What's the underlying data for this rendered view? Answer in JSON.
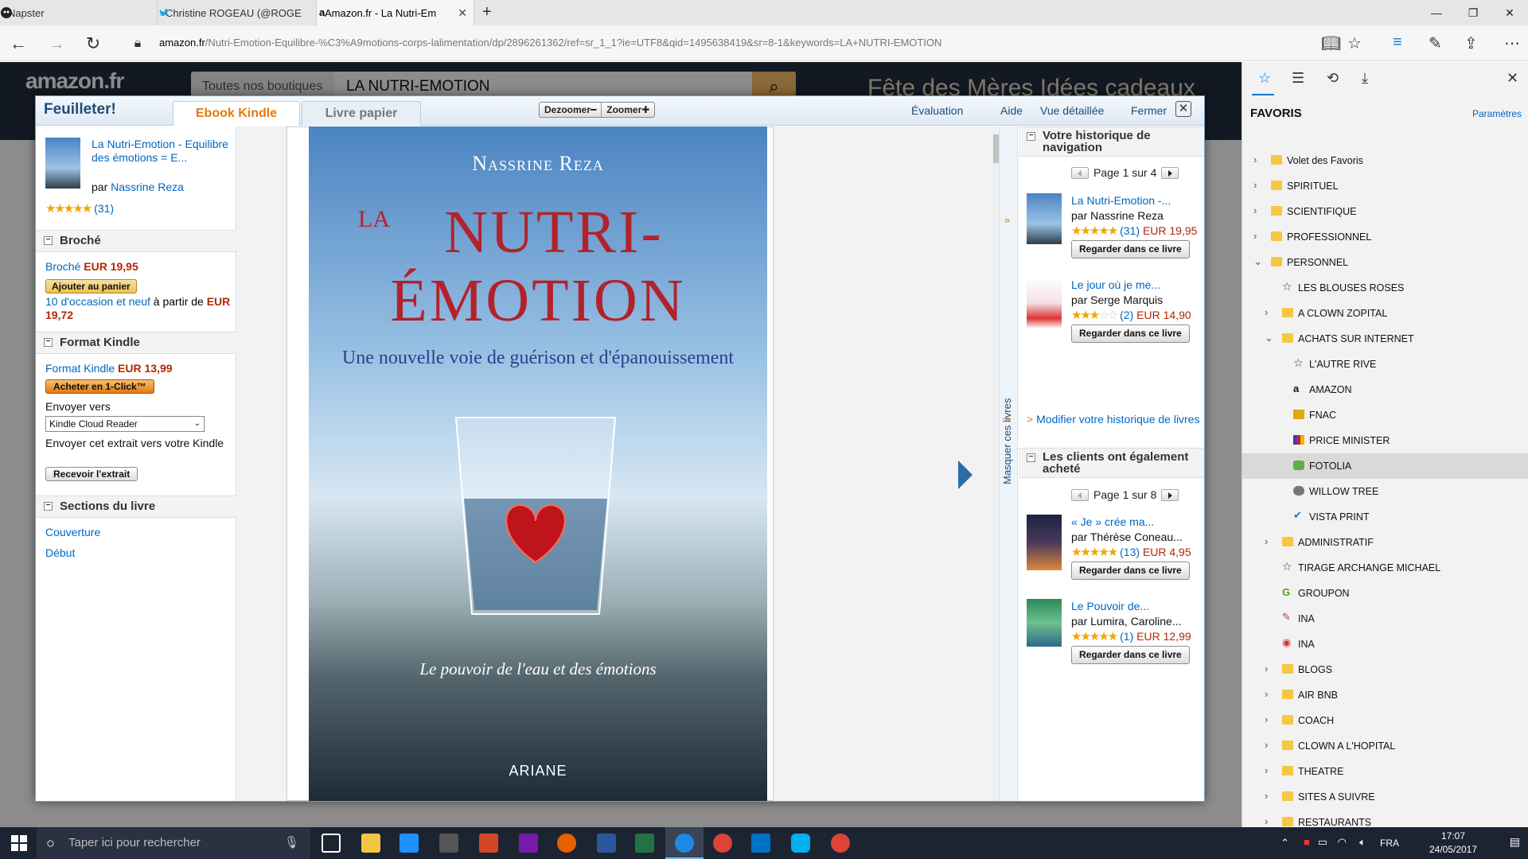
{
  "browser": {
    "tabs": [
      {
        "title": "Napster",
        "active": false
      },
      {
        "title": "Christine ROGEAU (@ROGE",
        "active": false
      },
      {
        "title": "Amazon.fr - La Nutri-Em",
        "active": true
      }
    ],
    "url_domain": "amazon.fr",
    "url_path": "/Nutri-Emotion-Equilibre-%C3%A9motions-corps-lalimentation/dp/2896261362/ref=sr_1_1?ie=UTF8&qid=1495638419&sr=8-1&keywords=LA+NUTRI-EMOTION"
  },
  "amazon": {
    "logo": "amazon.fr",
    "search_department": "Toutes nos boutiques",
    "search_query": "LA NUTRI-EMOTION",
    "promo": "Fête des Mères Idées cadeaux"
  },
  "viewer": {
    "title": "Feuilleter!",
    "tab_kindle": "Ebook Kindle",
    "tab_paper": "Livre papier",
    "zoom_out": "Dezoomer",
    "zoom_in": "Zoomer",
    "links": [
      "Évaluation",
      "Aide",
      "Vue détaillée",
      "Fermer"
    ],
    "book": {
      "title": "La Nutri-Emotion - Equilibre des émotions = E...",
      "by": "par",
      "author": "Nassrine Reza",
      "rating_count": "(31)"
    },
    "broche": {
      "header": "Broché",
      "label": "Broché",
      "price": "EUR 19,95",
      "add_button": "Ajouter au panier",
      "used_link": "10 d'occasion et neuf",
      "used_text": "à partir de",
      "used_price": "EUR 19,72"
    },
    "kindle": {
      "header": "Format Kindle",
      "label": "Format Kindle",
      "price": "EUR 13,99",
      "buy_button": "Acheter en 1-Click™",
      "send_to": "Envoyer vers",
      "device": "Kindle Cloud Reader",
      "send_text": "Envoyer cet extrait vers votre Kindle",
      "receive_button": "Recevoir l'extrait"
    },
    "sections": {
      "header": "Sections du livre",
      "items": [
        "Couverture",
        "Début"
      ]
    },
    "cover": {
      "author": "Nassrine Reza",
      "title_la": "LA",
      "title_line1": "NUTRI-",
      "title_line2": "ÉMOTION",
      "subtitle": "Une nouvelle voie de guérison et d'épanouissement",
      "tagline": "Le pouvoir de l'eau et des émotions",
      "publisher": "ARIANE"
    },
    "hide_books": "Masquer ces livres",
    "history": {
      "header": "Votre historique de navigation",
      "pager": "Page 1 sur 4",
      "items": [
        {
          "title": "La Nutri-Emotion -...",
          "author": "par Nassrine Reza",
          "count": "(31)",
          "price": "EUR 19,95",
          "button": "Regarder dans ce livre"
        },
        {
          "title": "Le jour où je me...",
          "author": "par Serge Marquis",
          "count": "(2)",
          "price": "EUR 14,90",
          "button": "Regarder dans ce livre"
        }
      ],
      "modify": "Modifier votre historique de livres"
    },
    "also_bought": {
      "header": "Les clients ont également acheté",
      "pager": "Page 1 sur 8",
      "items": [
        {
          "title": "« Je » crée ma...",
          "author": "par Thérèse Coneau...",
          "count": "(13)",
          "price": "EUR 4,95",
          "button": "Regarder dans ce livre"
        },
        {
          "title": "Le Pouvoir de...",
          "author": "par Lumira, Caroline...",
          "count": "(1)",
          "price": "EUR 12,99",
          "button": "Regarder dans ce livre"
        }
      ]
    }
  },
  "favorites": {
    "header": "FAVORIS",
    "settings": "Paramètres",
    "items": [
      {
        "label": "Volet des Favoris",
        "type": "folder",
        "level": 0,
        "state": "collapsed"
      },
      {
        "label": "SPIRITUEL",
        "type": "folder",
        "level": 0,
        "state": "collapsed"
      },
      {
        "label": "SCIENTIFIQUE",
        "type": "folder",
        "level": 0,
        "state": "collapsed"
      },
      {
        "label": "PROFESSIONNEL",
        "type": "folder",
        "level": 0,
        "state": "collapsed"
      },
      {
        "label": "PERSONNEL",
        "type": "folder",
        "level": 0,
        "state": "expanded"
      },
      {
        "label": "LES BLOUSES ROSES",
        "type": "star",
        "level": 1,
        "state": ""
      },
      {
        "label": "A CLOWN ZOPITAL",
        "type": "folder",
        "level": 1,
        "state": "collapsed"
      },
      {
        "label": "ACHATS SUR INTERNET",
        "type": "folder",
        "level": 1,
        "state": "expanded"
      },
      {
        "label": "L'AUTRE RIVE",
        "type": "star",
        "level": 2,
        "state": ""
      },
      {
        "label": "AMAZON",
        "type": "amazon",
        "level": 2,
        "state": ""
      },
      {
        "label": "FNAC",
        "type": "fnac",
        "level": 2,
        "state": ""
      },
      {
        "label": "PRICE MINISTER",
        "type": "pm",
        "level": 2,
        "state": ""
      },
      {
        "label": "FOTOLIA",
        "type": "fotolia",
        "level": 2,
        "state": "selected"
      },
      {
        "label": "WILLOW TREE",
        "type": "willow",
        "level": 2,
        "state": ""
      },
      {
        "label": "VISTA PRINT",
        "type": "vista",
        "level": 2,
        "state": ""
      },
      {
        "label": "ADMINISTRATIF",
        "type": "folder",
        "level": 1,
        "state": "collapsed"
      },
      {
        "label": "TIRAGE ARCHANGE MICHAEL",
        "type": "star",
        "level": 1,
        "state": ""
      },
      {
        "label": "GROUPON",
        "type": "groupon",
        "level": 1,
        "state": ""
      },
      {
        "label": "INA",
        "type": "ina",
        "level": 1,
        "state": ""
      },
      {
        "label": "INA",
        "type": "ina2",
        "level": 1,
        "state": ""
      },
      {
        "label": "BLOGS",
        "type": "folder",
        "level": 1,
        "state": "collapsed"
      },
      {
        "label": "AIR BNB",
        "type": "folder",
        "level": 1,
        "state": "collapsed"
      },
      {
        "label": "COACH",
        "type": "folder",
        "level": 1,
        "state": "collapsed"
      },
      {
        "label": "CLOWN A L'HOPITAL",
        "type": "folder",
        "level": 1,
        "state": "collapsed"
      },
      {
        "label": "THEATRE",
        "type": "folder",
        "level": 1,
        "state": "collapsed"
      },
      {
        "label": "SITES A SUIVRE",
        "type": "folder",
        "level": 1,
        "state": "collapsed"
      },
      {
        "label": "RESTAURANTS",
        "type": "folder",
        "level": 1,
        "state": "collapsed"
      }
    ]
  },
  "taskbar": {
    "search_placeholder": "Taper ici pour rechercher",
    "language": "FRA",
    "time": "17:07",
    "date": "24/05/2017"
  }
}
